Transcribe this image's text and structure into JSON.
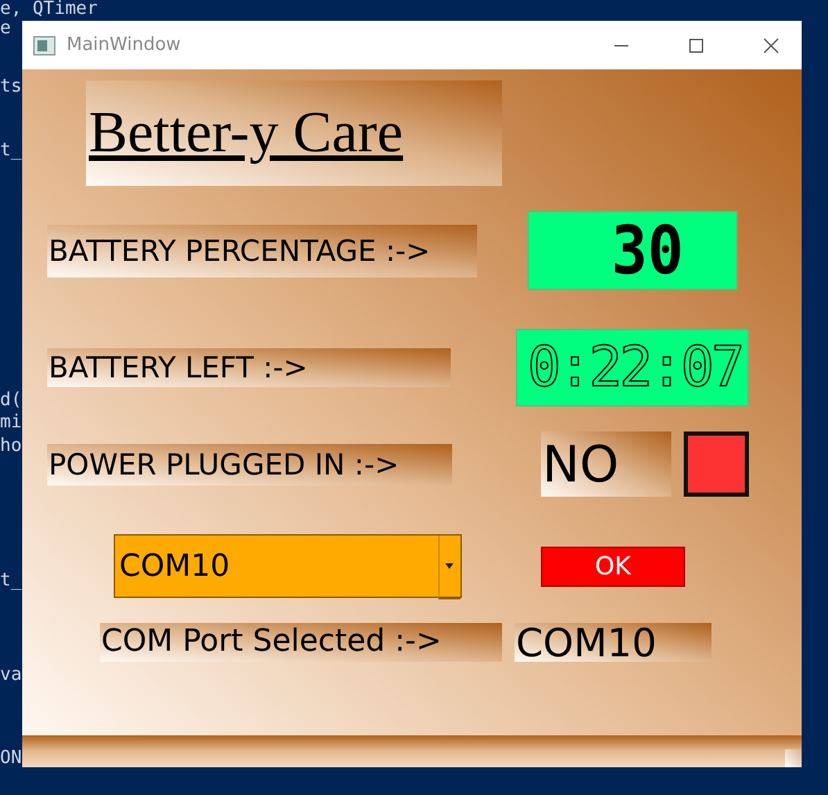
{
  "editor_behind": [
    {
      "text": "e, QTimer"
    },
    {
      "text": "e"
    },
    {
      "text": "ts"
    },
    {
      "text": "t_"
    },
    {
      "text": "d("
    },
    {
      "text": "mi"
    },
    {
      "text": "ho"
    },
    {
      "text": "t_"
    },
    {
      "text": "va"
    },
    {
      "text": "ON"
    }
  ],
  "window": {
    "title": "MainWindow"
  },
  "heading": "Better-y Care",
  "battery_percentage": {
    "label": "BATTERY PERCENTAGE :->",
    "display": "30"
  },
  "battery_left": {
    "label": "BATTERY LEFT :->",
    "display": "0:22:07"
  },
  "power": {
    "label": "POWER PLUGGED IN  :->",
    "value": "NO",
    "plugged": false
  },
  "port": {
    "combo_value": "COM10",
    "ok_button": "OK",
    "selected_label": "COM Port Selected :->",
    "selected_value": "COM10"
  }
}
